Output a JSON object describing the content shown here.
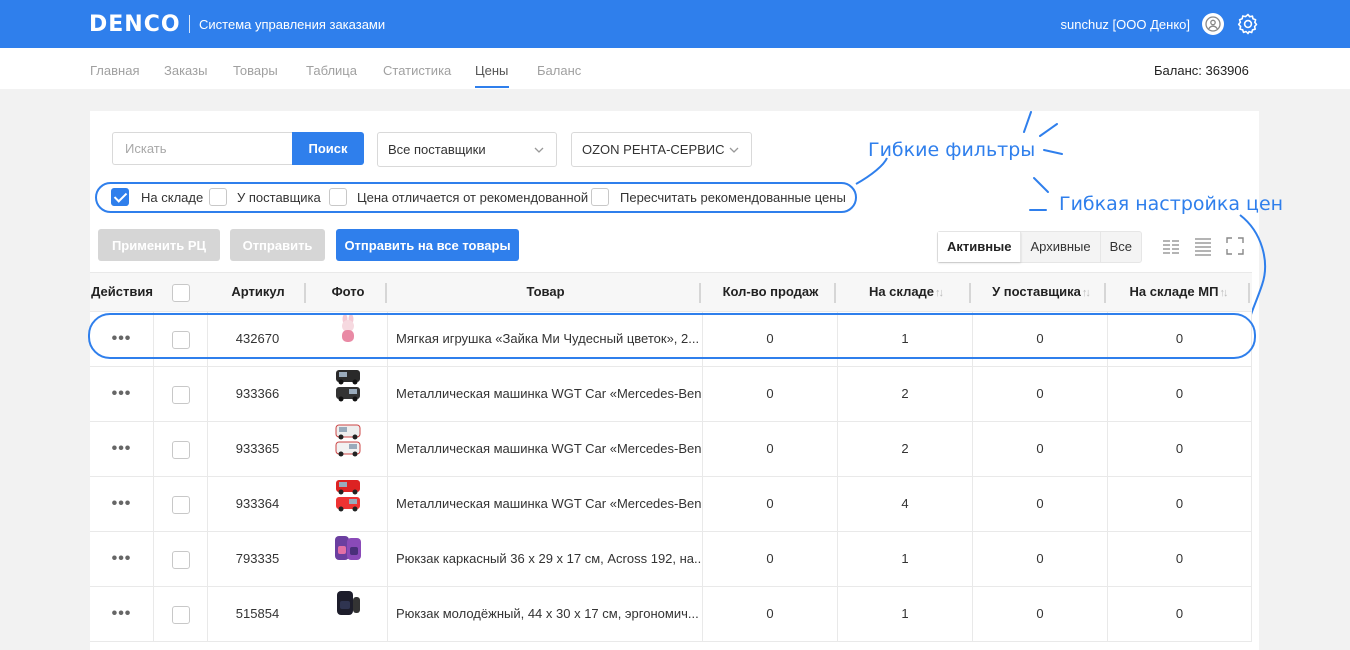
{
  "header": {
    "logo": "DENCO",
    "app_title": "Система управления заказами",
    "user": "sunchuz [ООО Денко]"
  },
  "nav": {
    "items": [
      "Главная",
      "Заказы",
      "Товары",
      "Таблица",
      "Статистика",
      "Цены",
      "Баланс"
    ],
    "active": "Цены",
    "balance": "Баланс: 363906"
  },
  "search": {
    "placeholder": "Искать",
    "value": "",
    "button": "Поиск"
  },
  "selects": {
    "suppliers": "Все поставщики",
    "store": "OZON РЕНТА-СЕРВИС"
  },
  "filters": [
    {
      "label": "На складе",
      "checked": true
    },
    {
      "label": "У поставщика",
      "checked": false
    },
    {
      "label": "Цена отличается от рекомендованной",
      "checked": false
    },
    {
      "label": "Пересчитать рекомендованные цены",
      "checked": false
    }
  ],
  "annotations": {
    "flexible_filters": "Гибкие фильтры",
    "flexible_pricing": "Гибкая настройка цен"
  },
  "actions": {
    "apply_rc": "Применить РЦ",
    "send": "Отправить",
    "send_all": "Отправить на все товары"
  },
  "segments": [
    "Активные",
    "Архивные",
    "Все"
  ],
  "active_segment": "Активные",
  "table": {
    "columns": [
      "Действия",
      "Артикул",
      "Фото",
      "Товар",
      "Кол-во продаж",
      "На складе",
      "У поставщика",
      "На складе МП"
    ],
    "rows": [
      {
        "actions": "•••",
        "article": "432670",
        "name": "Мягкая игрушка «Зайка Ми Чудесный цветок», 2...",
        "sales": "0",
        "stock": "1",
        "supplier": "0",
        "mp_stock": "0",
        "photo": "plush-bunny"
      },
      {
        "actions": "•••",
        "article": "933366",
        "name": "Металлическая машинка WGT Car «Mercedes-Ben...",
        "sales": "0",
        "stock": "2",
        "supplier": "0",
        "mp_stock": "0",
        "photo": "toy-car-black"
      },
      {
        "actions": "•••",
        "article": "933365",
        "name": "Металлическая машинка WGT Car «Mercedes-Ben...",
        "sales": "0",
        "stock": "2",
        "supplier": "0",
        "mp_stock": "0",
        "photo": "toy-car-white"
      },
      {
        "actions": "•••",
        "article": "933364",
        "name": "Металлическая машинка WGT Car «Mercedes-Ben...",
        "sales": "0",
        "stock": "4",
        "supplier": "0",
        "mp_stock": "0",
        "photo": "toy-car-red"
      },
      {
        "actions": "•••",
        "article": "793335",
        "name": "Рюкзак каркасный 36 х 29 х 17 см, Across 192, на...",
        "sales": "0",
        "stock": "1",
        "supplier": "0",
        "mp_stock": "0",
        "photo": "backpack-purple"
      },
      {
        "actions": "•••",
        "article": "515854",
        "name": "Рюкзак молодёжный, 44 х 30 х 17 см, эргономич...",
        "sales": "0",
        "stock": "1",
        "supplier": "0",
        "mp_stock": "0",
        "photo": "backpack-black"
      }
    ]
  },
  "colors": {
    "primary": "#2f7fec",
    "disabled": "#d6d6d6"
  }
}
